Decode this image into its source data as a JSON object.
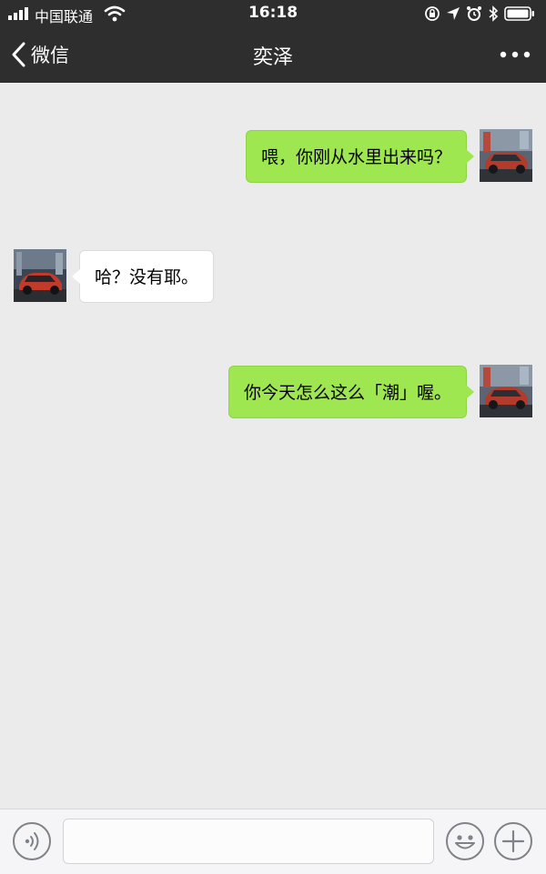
{
  "status_bar": {
    "carrier": "中国联通",
    "time": "16:18"
  },
  "nav": {
    "back_label": "微信",
    "title": "奕泽",
    "more_icon": "more-dots-icon"
  },
  "messages": [
    {
      "direction": "outgoing",
      "text": "喂，你刚从水里出来吗？",
      "avatar": "car-avatar"
    },
    {
      "direction": "incoming",
      "text": "哈？没有耶。",
      "avatar": "car-avatar"
    },
    {
      "direction": "outgoing",
      "text": "你今天怎么这么「潮」喔。",
      "avatar": "car-avatar"
    }
  ],
  "input_bar": {
    "value": "",
    "voice_icon": "voice-icon",
    "emoji_icon": "emoji-icon",
    "plus_icon": "plus-icon"
  },
  "colors": {
    "nav_background": "#2e2e2e",
    "chat_background": "#ebebeb",
    "outgoing_bubble": "#9ee750",
    "incoming_bubble": "#ffffff"
  }
}
